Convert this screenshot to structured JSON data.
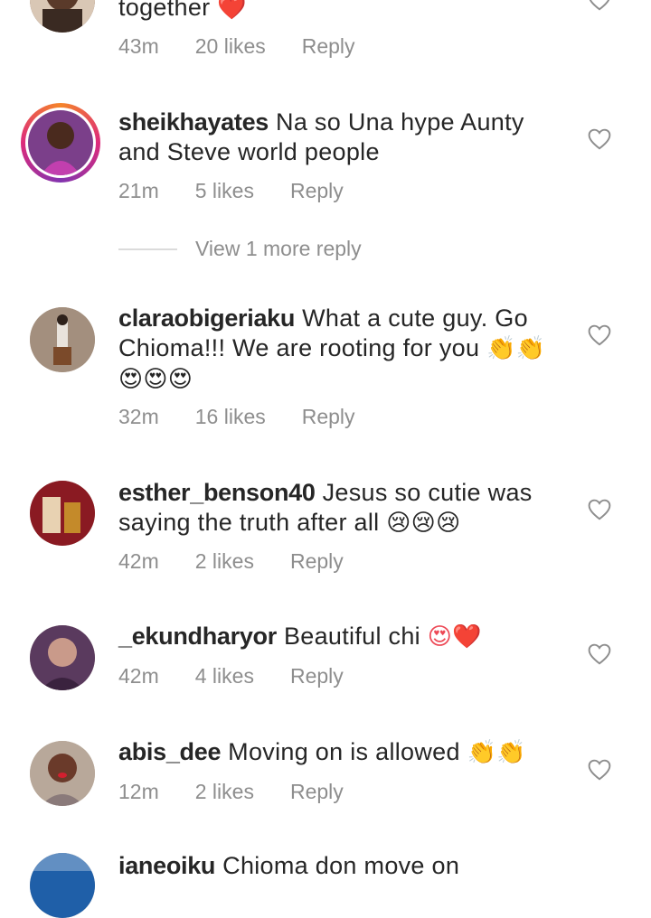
{
  "comments": [
    {
      "username": "",
      "text": "together",
      "emoji": "❤️",
      "time": "43m",
      "likes": "20 likes",
      "reply": "Reply"
    },
    {
      "username": "sheikhayates",
      "text": "Na so Una hype Aunty and Steve world people",
      "emoji": "",
      "time": "21m",
      "likes": "5 likes",
      "reply": "Reply"
    },
    {
      "username": "claraobigeriaku",
      "text": "What a cute guy. Go Chioma!!! We are rooting for you",
      "emoji": "👏👏 😍😍😍",
      "time": "32m",
      "likes": "16 likes",
      "reply": "Reply"
    },
    {
      "username": "esther_benson40",
      "text": "Jesus so cutie was saying the truth after all",
      "emoji": "😢😢😢",
      "time": "42m",
      "likes": "2 likes",
      "reply": "Reply"
    },
    {
      "username": "_ekundharyor",
      "text": "Beautiful chi",
      "emoji": "😍❤️",
      "time": "42m",
      "likes": "4 likes",
      "reply": "Reply"
    },
    {
      "username": "abis_dee",
      "text": "Moving  on is allowed",
      "emoji": "👏👏",
      "time": "12m",
      "likes": "2 likes",
      "reply": "Reply"
    },
    {
      "username": "ianeoiku",
      "text": "Chioma don move on",
      "emoji": "",
      "time": "",
      "likes": "",
      "reply": ""
    }
  ],
  "view_more": "View 1 more reply",
  "icons": {
    "heart": "heart-outline-icon",
    "avatar": "avatar"
  },
  "colors": {
    "muted": "#8e8e8e",
    "text": "#262626",
    "heart_red": "#ed4956"
  }
}
